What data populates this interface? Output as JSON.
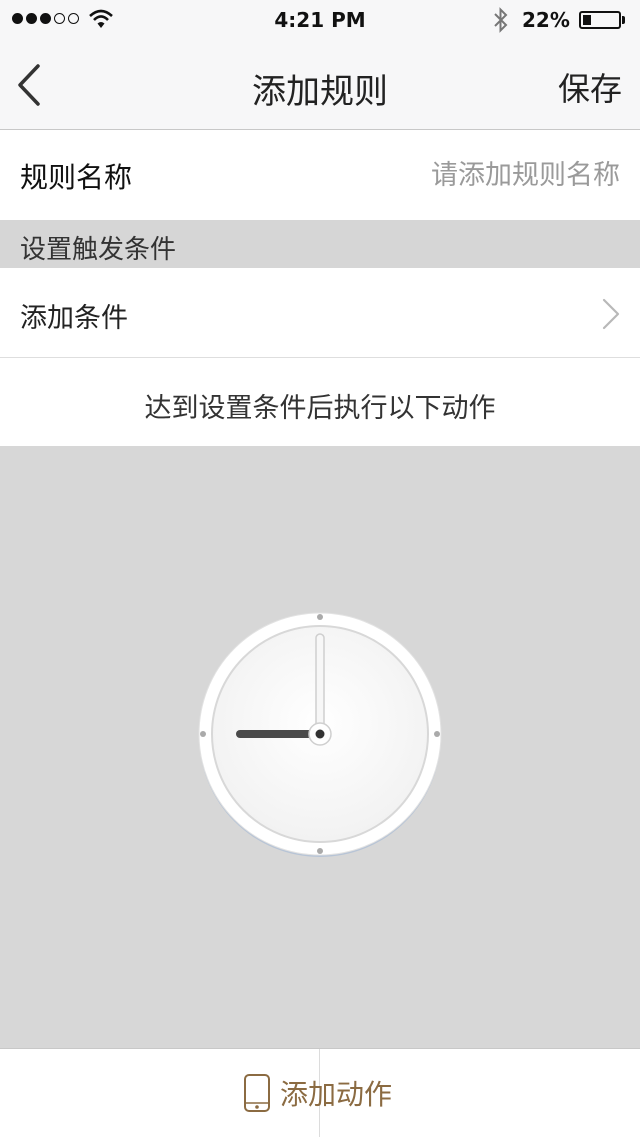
{
  "status_bar": {
    "time": "4:21 PM",
    "battery": "22%",
    "signal_bars_filled": 3,
    "signal_bars_total": 5,
    "battery_level": 0.22
  },
  "nav": {
    "back_icon": "chevron-left-icon",
    "title": "添加规则",
    "save_label": "保存"
  },
  "rule_name": {
    "label": "规则名称",
    "value": "",
    "placeholder": "请添加规则名称"
  },
  "trigger_section": {
    "header": "设置触发条件",
    "add_condition_label": "添加条件",
    "chevron_icon": "chevron-right-icon"
  },
  "action_section": {
    "caption": "达到设置条件后执行以下动作",
    "illustration_icon": "clock-icon"
  },
  "bottom_bar": {
    "add_action_label": "添加动作",
    "icon": "phone-icon",
    "accent_color": "#8b6b42"
  }
}
